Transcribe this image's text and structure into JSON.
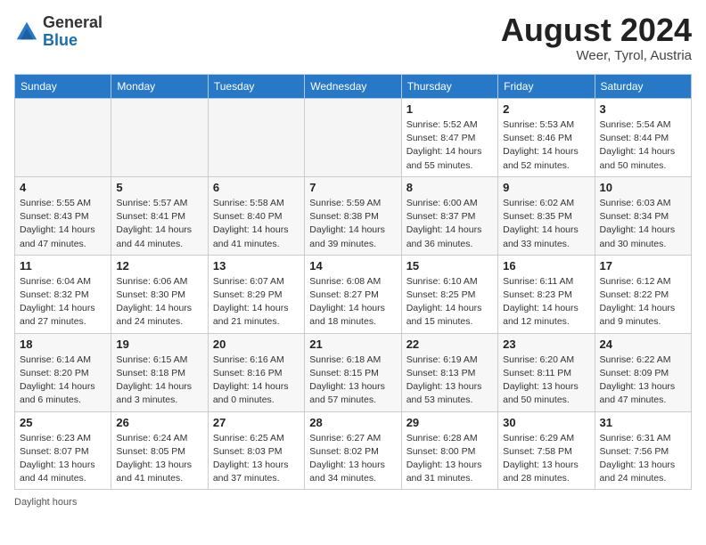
{
  "header": {
    "logo_general": "General",
    "logo_blue": "Blue",
    "month_year": "August 2024",
    "location": "Weer, Tyrol, Austria"
  },
  "days_of_week": [
    "Sunday",
    "Monday",
    "Tuesday",
    "Wednesday",
    "Thursday",
    "Friday",
    "Saturday"
  ],
  "footer": {
    "note": "Daylight hours"
  },
  "weeks": [
    [
      {
        "day": "",
        "detail": ""
      },
      {
        "day": "",
        "detail": ""
      },
      {
        "day": "",
        "detail": ""
      },
      {
        "day": "",
        "detail": ""
      },
      {
        "day": "1",
        "detail": "Sunrise: 5:52 AM\nSunset: 8:47 PM\nDaylight: 14 hours\nand 55 minutes."
      },
      {
        "day": "2",
        "detail": "Sunrise: 5:53 AM\nSunset: 8:46 PM\nDaylight: 14 hours\nand 52 minutes."
      },
      {
        "day": "3",
        "detail": "Sunrise: 5:54 AM\nSunset: 8:44 PM\nDaylight: 14 hours\nand 50 minutes."
      }
    ],
    [
      {
        "day": "4",
        "detail": "Sunrise: 5:55 AM\nSunset: 8:43 PM\nDaylight: 14 hours\nand 47 minutes."
      },
      {
        "day": "5",
        "detail": "Sunrise: 5:57 AM\nSunset: 8:41 PM\nDaylight: 14 hours\nand 44 minutes."
      },
      {
        "day": "6",
        "detail": "Sunrise: 5:58 AM\nSunset: 8:40 PM\nDaylight: 14 hours\nand 41 minutes."
      },
      {
        "day": "7",
        "detail": "Sunrise: 5:59 AM\nSunset: 8:38 PM\nDaylight: 14 hours\nand 39 minutes."
      },
      {
        "day": "8",
        "detail": "Sunrise: 6:00 AM\nSunset: 8:37 PM\nDaylight: 14 hours\nand 36 minutes."
      },
      {
        "day": "9",
        "detail": "Sunrise: 6:02 AM\nSunset: 8:35 PM\nDaylight: 14 hours\nand 33 minutes."
      },
      {
        "day": "10",
        "detail": "Sunrise: 6:03 AM\nSunset: 8:34 PM\nDaylight: 14 hours\nand 30 minutes."
      }
    ],
    [
      {
        "day": "11",
        "detail": "Sunrise: 6:04 AM\nSunset: 8:32 PM\nDaylight: 14 hours\nand 27 minutes."
      },
      {
        "day": "12",
        "detail": "Sunrise: 6:06 AM\nSunset: 8:30 PM\nDaylight: 14 hours\nand 24 minutes."
      },
      {
        "day": "13",
        "detail": "Sunrise: 6:07 AM\nSunset: 8:29 PM\nDaylight: 14 hours\nand 21 minutes."
      },
      {
        "day": "14",
        "detail": "Sunrise: 6:08 AM\nSunset: 8:27 PM\nDaylight: 14 hours\nand 18 minutes."
      },
      {
        "day": "15",
        "detail": "Sunrise: 6:10 AM\nSunset: 8:25 PM\nDaylight: 14 hours\nand 15 minutes."
      },
      {
        "day": "16",
        "detail": "Sunrise: 6:11 AM\nSunset: 8:23 PM\nDaylight: 14 hours\nand 12 minutes."
      },
      {
        "day": "17",
        "detail": "Sunrise: 6:12 AM\nSunset: 8:22 PM\nDaylight: 14 hours\nand 9 minutes."
      }
    ],
    [
      {
        "day": "18",
        "detail": "Sunrise: 6:14 AM\nSunset: 8:20 PM\nDaylight: 14 hours\nand 6 minutes."
      },
      {
        "day": "19",
        "detail": "Sunrise: 6:15 AM\nSunset: 8:18 PM\nDaylight: 14 hours\nand 3 minutes."
      },
      {
        "day": "20",
        "detail": "Sunrise: 6:16 AM\nSunset: 8:16 PM\nDaylight: 14 hours\nand 0 minutes."
      },
      {
        "day": "21",
        "detail": "Sunrise: 6:18 AM\nSunset: 8:15 PM\nDaylight: 13 hours\nand 57 minutes."
      },
      {
        "day": "22",
        "detail": "Sunrise: 6:19 AM\nSunset: 8:13 PM\nDaylight: 13 hours\nand 53 minutes."
      },
      {
        "day": "23",
        "detail": "Sunrise: 6:20 AM\nSunset: 8:11 PM\nDaylight: 13 hours\nand 50 minutes."
      },
      {
        "day": "24",
        "detail": "Sunrise: 6:22 AM\nSunset: 8:09 PM\nDaylight: 13 hours\nand 47 minutes."
      }
    ],
    [
      {
        "day": "25",
        "detail": "Sunrise: 6:23 AM\nSunset: 8:07 PM\nDaylight: 13 hours\nand 44 minutes."
      },
      {
        "day": "26",
        "detail": "Sunrise: 6:24 AM\nSunset: 8:05 PM\nDaylight: 13 hours\nand 41 minutes."
      },
      {
        "day": "27",
        "detail": "Sunrise: 6:25 AM\nSunset: 8:03 PM\nDaylight: 13 hours\nand 37 minutes."
      },
      {
        "day": "28",
        "detail": "Sunrise: 6:27 AM\nSunset: 8:02 PM\nDaylight: 13 hours\nand 34 minutes."
      },
      {
        "day": "29",
        "detail": "Sunrise: 6:28 AM\nSunset: 8:00 PM\nDaylight: 13 hours\nand 31 minutes."
      },
      {
        "day": "30",
        "detail": "Sunrise: 6:29 AM\nSunset: 7:58 PM\nDaylight: 13 hours\nand 28 minutes."
      },
      {
        "day": "31",
        "detail": "Sunrise: 6:31 AM\nSunset: 7:56 PM\nDaylight: 13 hours\nand 24 minutes."
      }
    ]
  ]
}
